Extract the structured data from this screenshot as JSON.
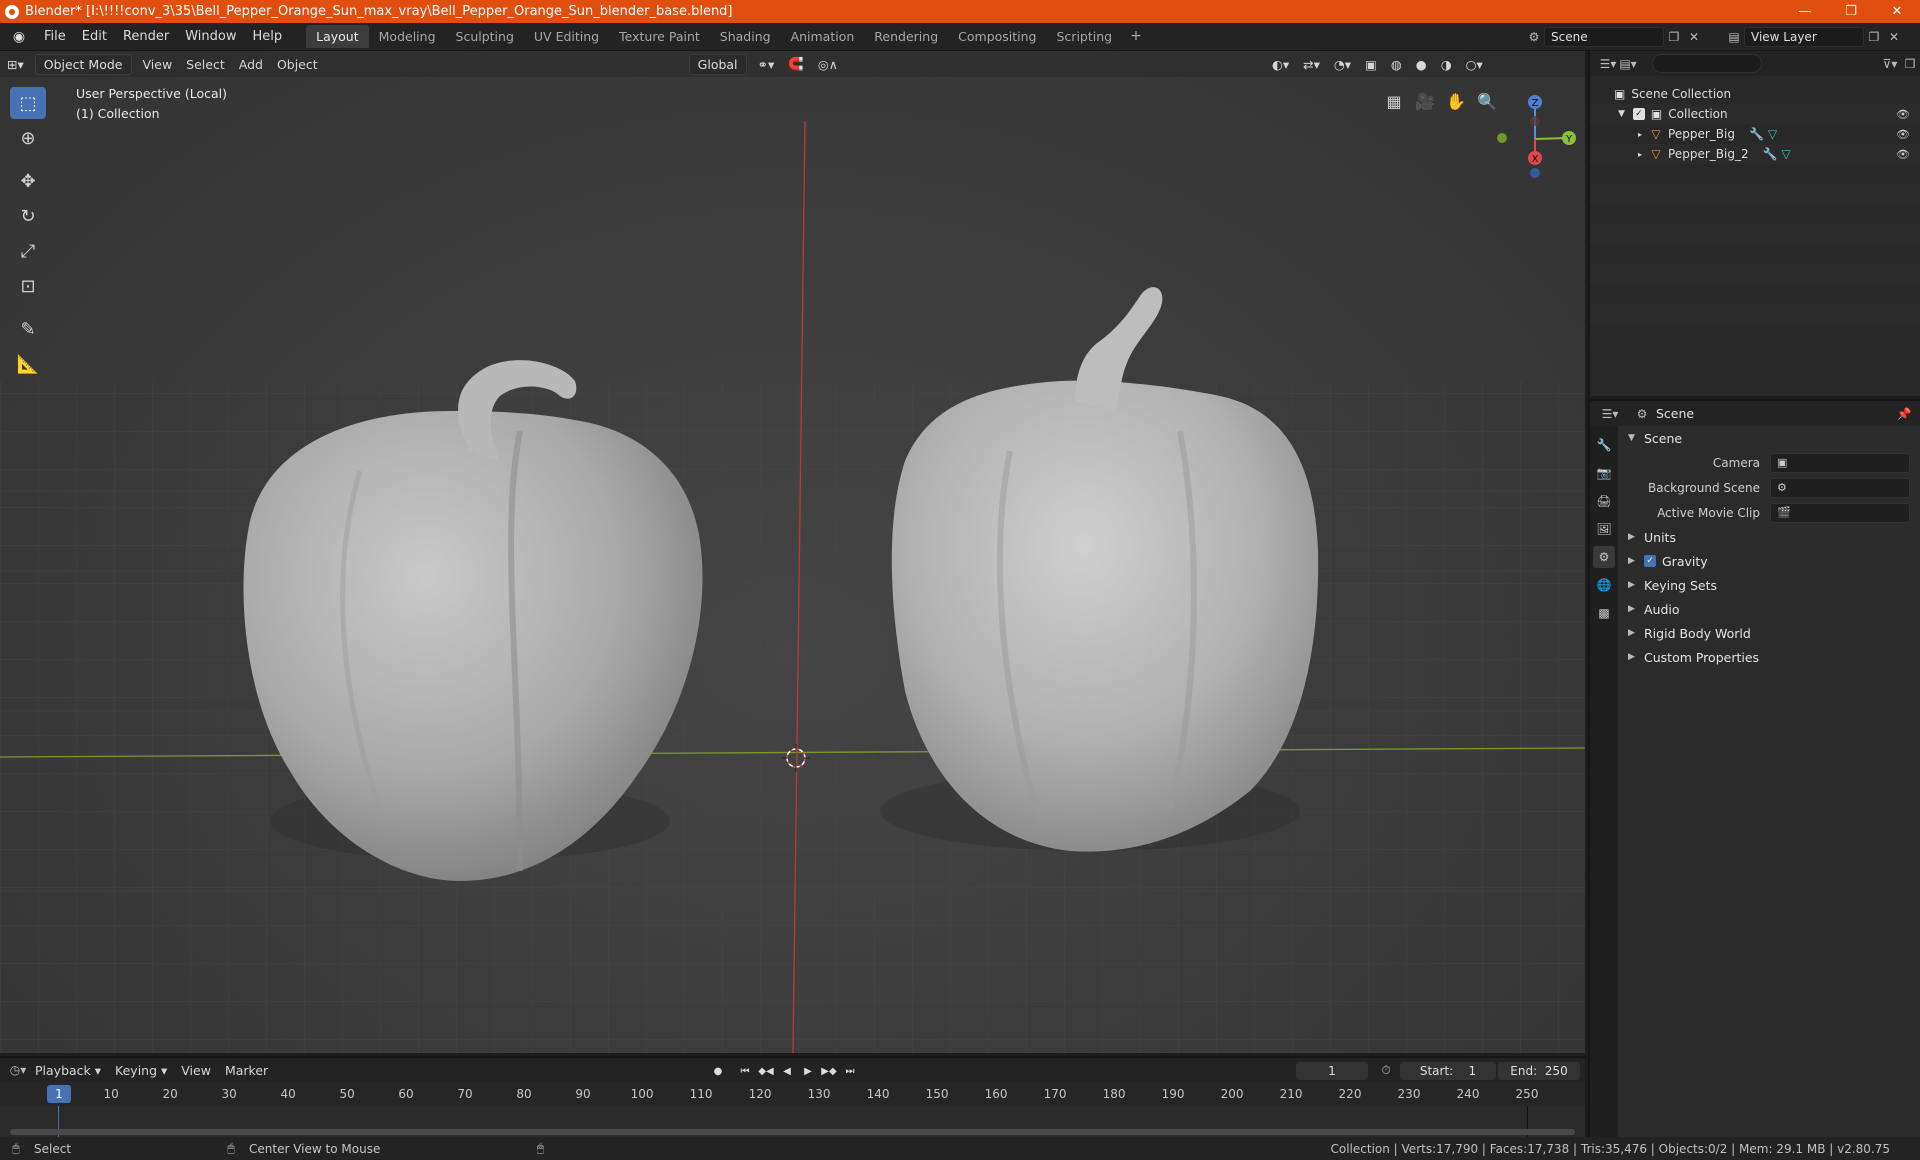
{
  "window": {
    "title": "Blender* [I:\\!!!!conv_3\\35\\Bell_Pepper_Orange_Sun_max_vray\\Bell_Pepper_Orange_Sun_blender_base.blend]",
    "minimize": "—",
    "restore": "❐",
    "close": "✕"
  },
  "menu": [
    "File",
    "Edit",
    "Render",
    "Window",
    "Help"
  ],
  "workspaces": [
    "Layout",
    "Modeling",
    "Sculpting",
    "UV Editing",
    "Texture Paint",
    "Shading",
    "Animation",
    "Rendering",
    "Compositing",
    "Scripting"
  ],
  "workspace_add": "+",
  "scene_name": "Scene",
  "view_layer": "View Layer",
  "viewport": {
    "mode": "Object Mode",
    "menus": [
      "View",
      "Select",
      "Add",
      "Object"
    ],
    "orientation": "Global",
    "info_line1": "User Perspective (Local)",
    "info_line2": "(1) Collection",
    "gizmo": {
      "z": "Z",
      "y": "Y",
      "x": "X"
    }
  },
  "outliner": {
    "search_placeholder": "",
    "root": "Scene Collection",
    "collection": "Collection",
    "objects": [
      "Pepper_Big",
      "Pepper_Big_2"
    ]
  },
  "properties": {
    "context": "Scene",
    "panel_title": "Scene",
    "camera_label": "Camera",
    "background_scene_label": "Background Scene",
    "active_clip_label": "Active Movie Clip",
    "subpanels": [
      "Units",
      "Gravity",
      "Keying Sets",
      "Audio",
      "Rigid Body World",
      "Custom Properties"
    ]
  },
  "timeline": {
    "menus": [
      "Playback",
      "Keying",
      "View",
      "Marker"
    ],
    "current_frame": "1",
    "start_label": "Start:",
    "start": "1",
    "end_label": "End:",
    "end": "250",
    "ticks": [
      "10",
      "20",
      "30",
      "40",
      "50",
      "60",
      "70",
      "80",
      "90",
      "100",
      "110",
      "120",
      "130",
      "140",
      "150",
      "160",
      "170",
      "180",
      "190",
      "200",
      "210",
      "220",
      "230",
      "240",
      "250"
    ]
  },
  "status": {
    "left": "Select",
    "middle": "Center View to Mouse",
    "right": "Collection | Verts:17,790 | Faces:17,738 | Tris:35,476 | Objects:0/2 | Mem: 29.1 MB | v2.80.75"
  },
  "colors": {
    "titlebar": "#e04e10",
    "accent": "#4772b3",
    "x_axis": "#c83c3c",
    "y_axis": "#80a030"
  }
}
